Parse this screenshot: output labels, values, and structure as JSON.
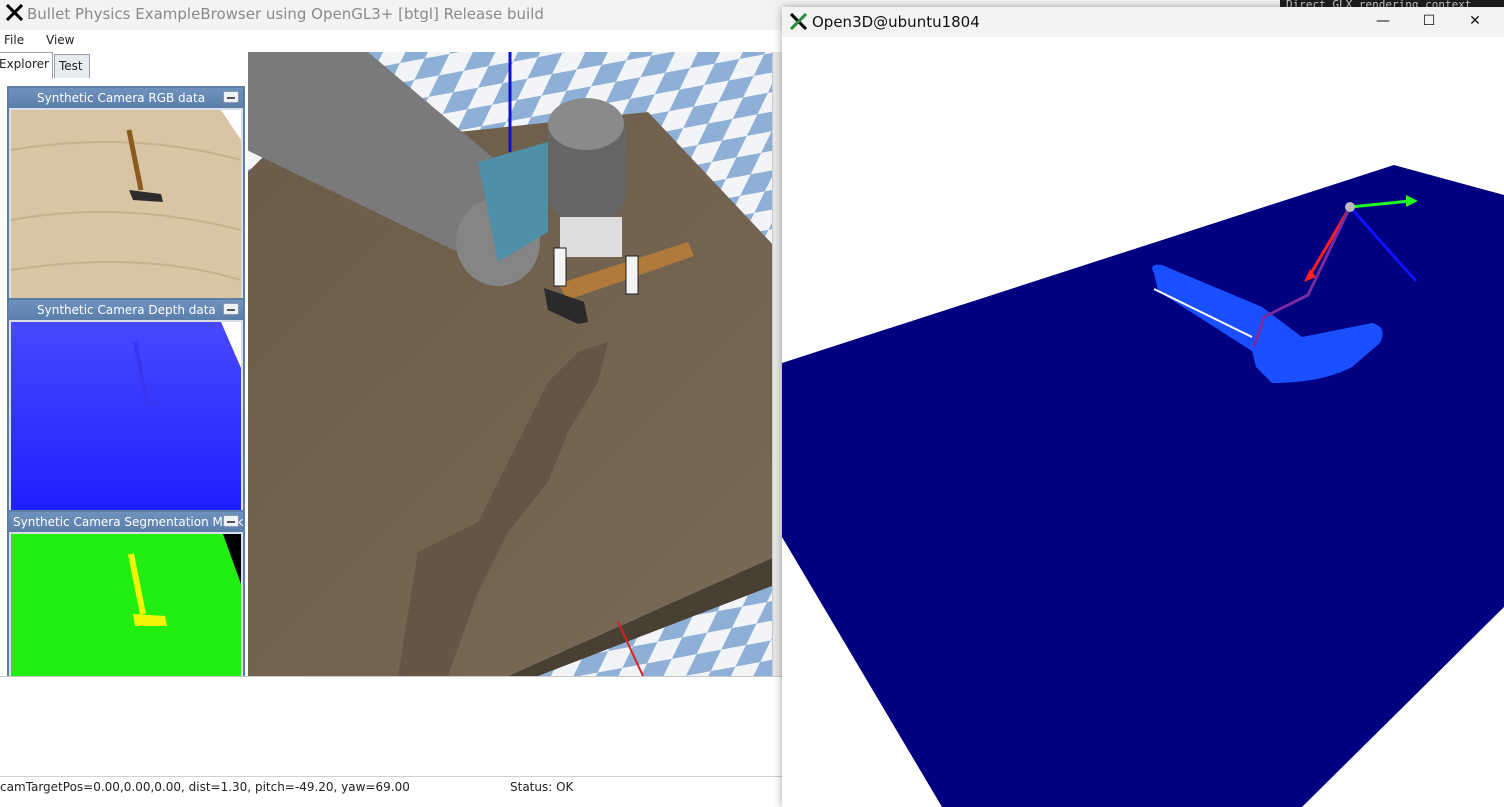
{
  "bullet_window": {
    "title": "Bullet Physics ExampleBrowser using OpenGL3+ [btgl] Release build",
    "menu": [
      "File",
      "View"
    ],
    "tabs": [
      "Explorer",
      "Test"
    ],
    "panels": [
      {
        "title": "Synthetic Camera RGB data"
      },
      {
        "title": "Synthetic Camera Depth data"
      },
      {
        "title": "Synthetic Camera Segmentation Mask"
      }
    ],
    "status_camera": "camTargetPos=0.00,0.00,0.00, dist=1.30, pitch=-49.20, yaw=69.00",
    "status_text": "Status: OK"
  },
  "open3d_window": {
    "title": "Open3D@ubuntu1804",
    "controls": {
      "minimize": "—",
      "maximize": "☐",
      "close": "✕"
    }
  },
  "background_terminal": {
    "text": "Direct GLX rendering context"
  },
  "colors": {
    "x_logo": "#000000",
    "open3d_plane": "#000080",
    "open3d_hammer": "#1a4fff",
    "depth_panel": "#2e2eff",
    "segmentation_bg": "#22ee11",
    "segmentation_hammer": "#f5f50a",
    "checker_blue": "#8fb0d6"
  }
}
